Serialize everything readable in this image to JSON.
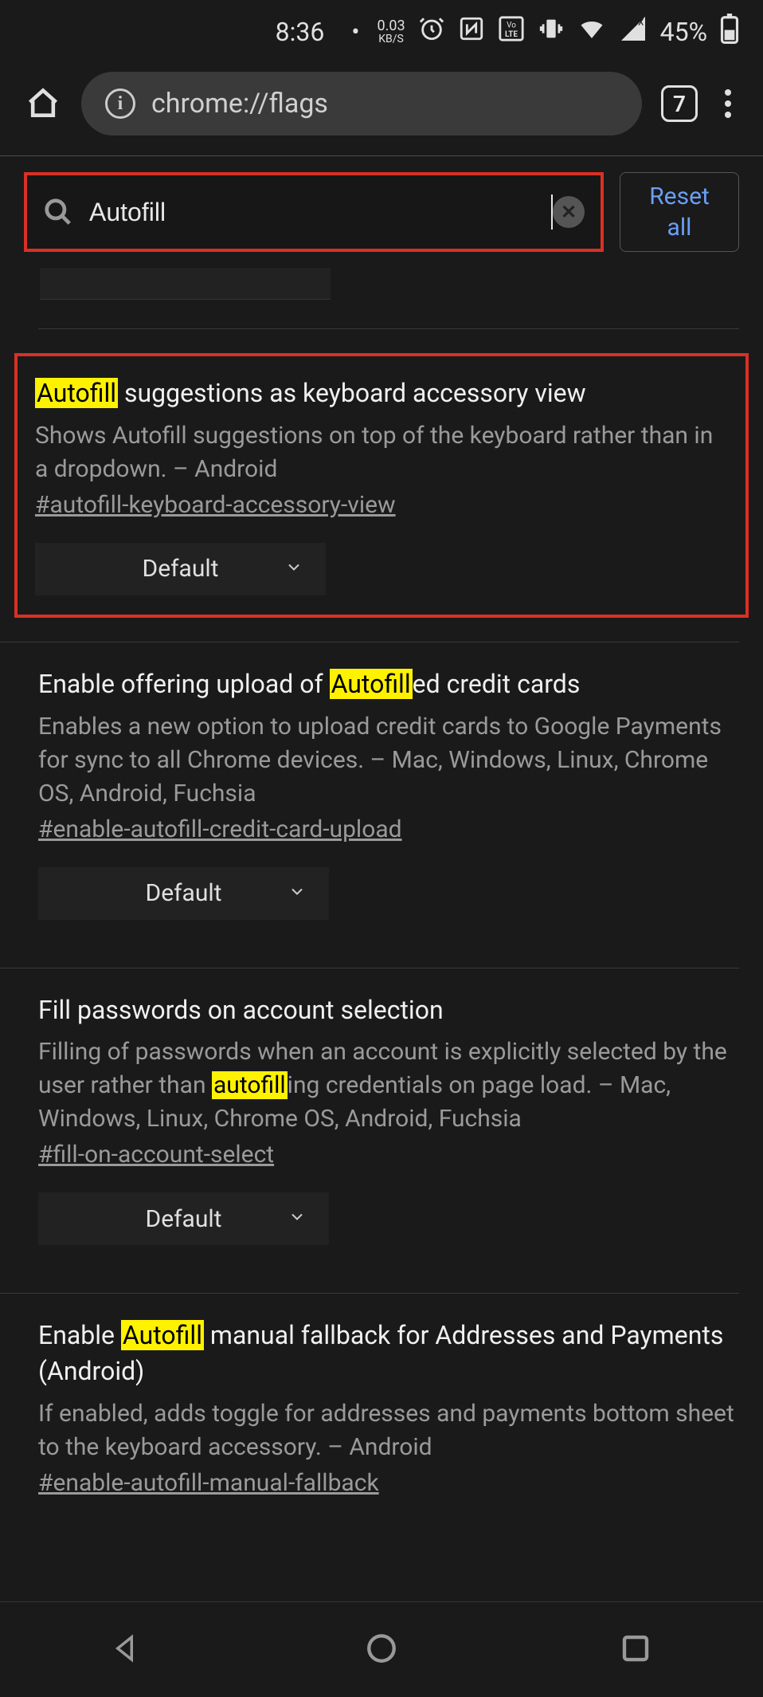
{
  "status": {
    "time": "8:36",
    "speed_top": "0.03",
    "speed_bot": "KB/S",
    "battery_pct": "45%"
  },
  "browser": {
    "url": "chrome://flags",
    "tab_count": "7"
  },
  "search": {
    "value": "Autofill",
    "reset_top": "Reset",
    "reset_bot": "all"
  },
  "flags": [
    {
      "title_pre": "",
      "title_hl": "Autofill",
      "title_post": " suggestions as keyboard accessory view",
      "desc": "Shows Autofill suggestions on top of the keyboard rather than in a dropdown. – Android",
      "hash": "#autofill-keyboard-accessory-view",
      "select": "Default"
    },
    {
      "title_pre": "Enable offering upload of ",
      "title_hl": "Autofill",
      "title_post": "ed credit cards",
      "desc": "Enables a new option to upload credit cards to Google Payments for sync to all Chrome devices. – Mac, Windows, Linux, Chrome OS, Android, Fuchsia",
      "hash": "#enable-autofill-credit-card-upload",
      "select": "Default"
    },
    {
      "title_pre_a": "Fill passwords on account selection",
      "desc_pre": "Filling of passwords when an account is explicitly selected by the user rather than ",
      "desc_hl": "autofill",
      "desc_post": "ing credentials on page load. – Mac, Windows, Linux, Chrome OS, Android, Fuchsia",
      "hash": "#fill-on-account-select",
      "select": "Default"
    },
    {
      "title_pre": "Enable ",
      "title_hl": "Autofill",
      "title_post": " manual fallback for Addresses and Payments (Android)",
      "desc": "If enabled, adds toggle for addresses and payments bottom sheet to the keyboard accessory. – Android",
      "hash": "#enable-autofill-manual-fallback"
    }
  ]
}
